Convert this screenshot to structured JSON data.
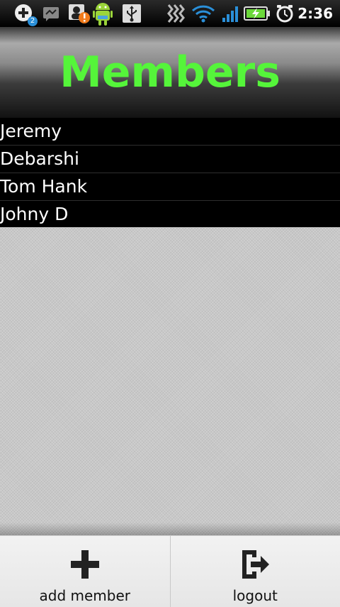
{
  "status_bar": {
    "notification_count": "2",
    "time": "2:36",
    "icons": [
      "add-notification-icon",
      "messaging-icon",
      "contact-alert-icon",
      "android-icon",
      "usb-icon",
      "vibrate-icon",
      "wifi-icon",
      "signal-icon",
      "battery-charging-icon",
      "alarm-clock-icon"
    ]
  },
  "header": {
    "title": "Members"
  },
  "members": [
    {
      "name": "Jeremy"
    },
    {
      "name": "Debarshi"
    },
    {
      "name": "Tom Hank"
    },
    {
      "name": "Johny D"
    }
  ],
  "bottom_bar": {
    "add_label": "add member",
    "logout_label": "logout"
  },
  "colors": {
    "title": "#55f53a",
    "list_background": "#000000",
    "list_text": "#ffffff",
    "empty_area": "#c8c8c8"
  }
}
